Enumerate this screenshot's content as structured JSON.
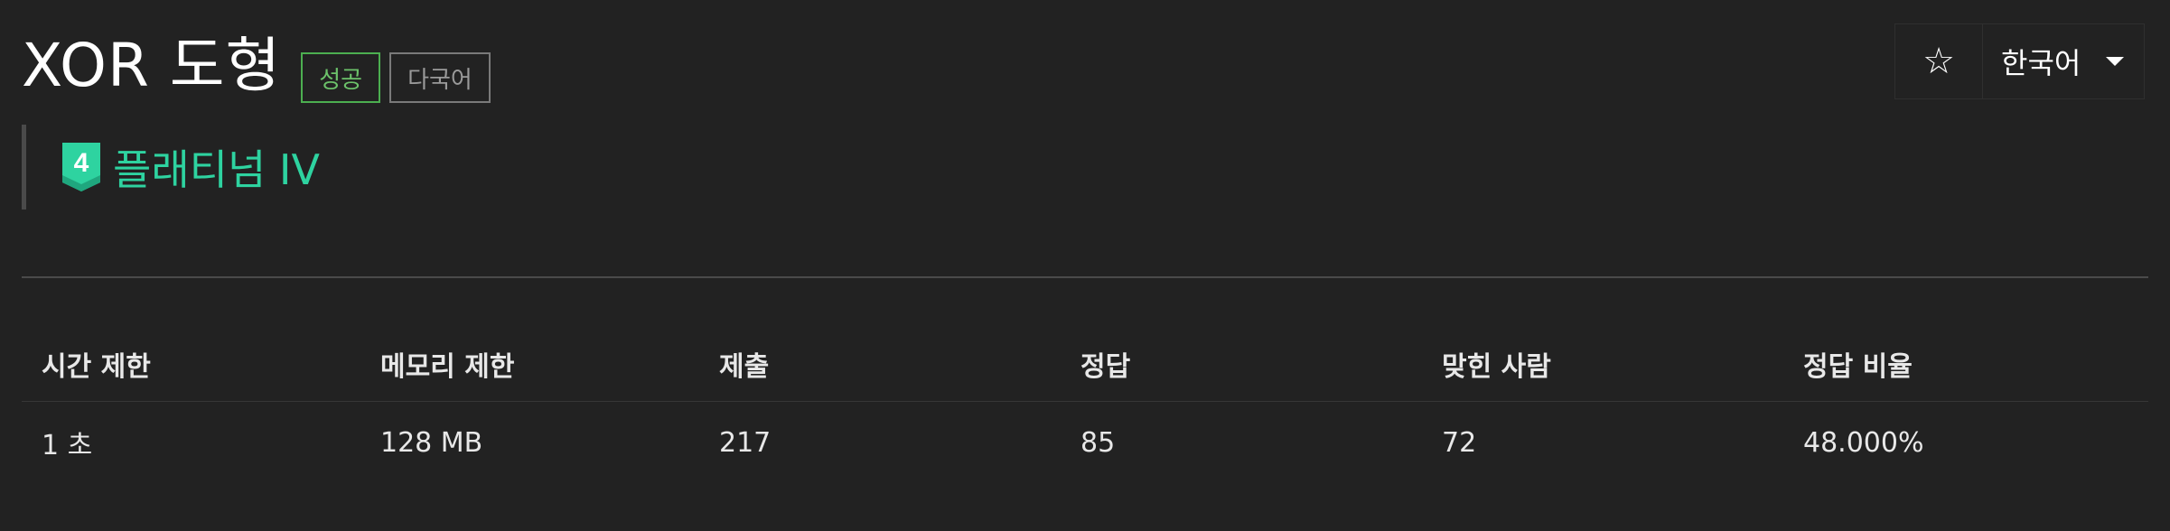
{
  "problem": {
    "title": "XOR 도형",
    "labels": {
      "success": "성공",
      "multilang": "다국어"
    },
    "tier": {
      "name": "플래티넘 IV",
      "level": "4",
      "icon": "platinum-tier-icon",
      "color": "#2ed3a0"
    }
  },
  "controls": {
    "star_icon": "star-icon",
    "star_glyph": "☆",
    "language": "한국어",
    "dropdown_icon": "caret-down-icon"
  },
  "info_table": {
    "headers": [
      "시간 제한",
      "메모리 제한",
      "제출",
      "정답",
      "맞힌 사람",
      "정답 비율"
    ],
    "values": [
      "1 초",
      "128 MB",
      "217",
      "85",
      "72",
      "48.000%"
    ]
  },
  "colors": {
    "background": "#222222",
    "success": "#4caf50",
    "tier": "#2ed3a0"
  }
}
